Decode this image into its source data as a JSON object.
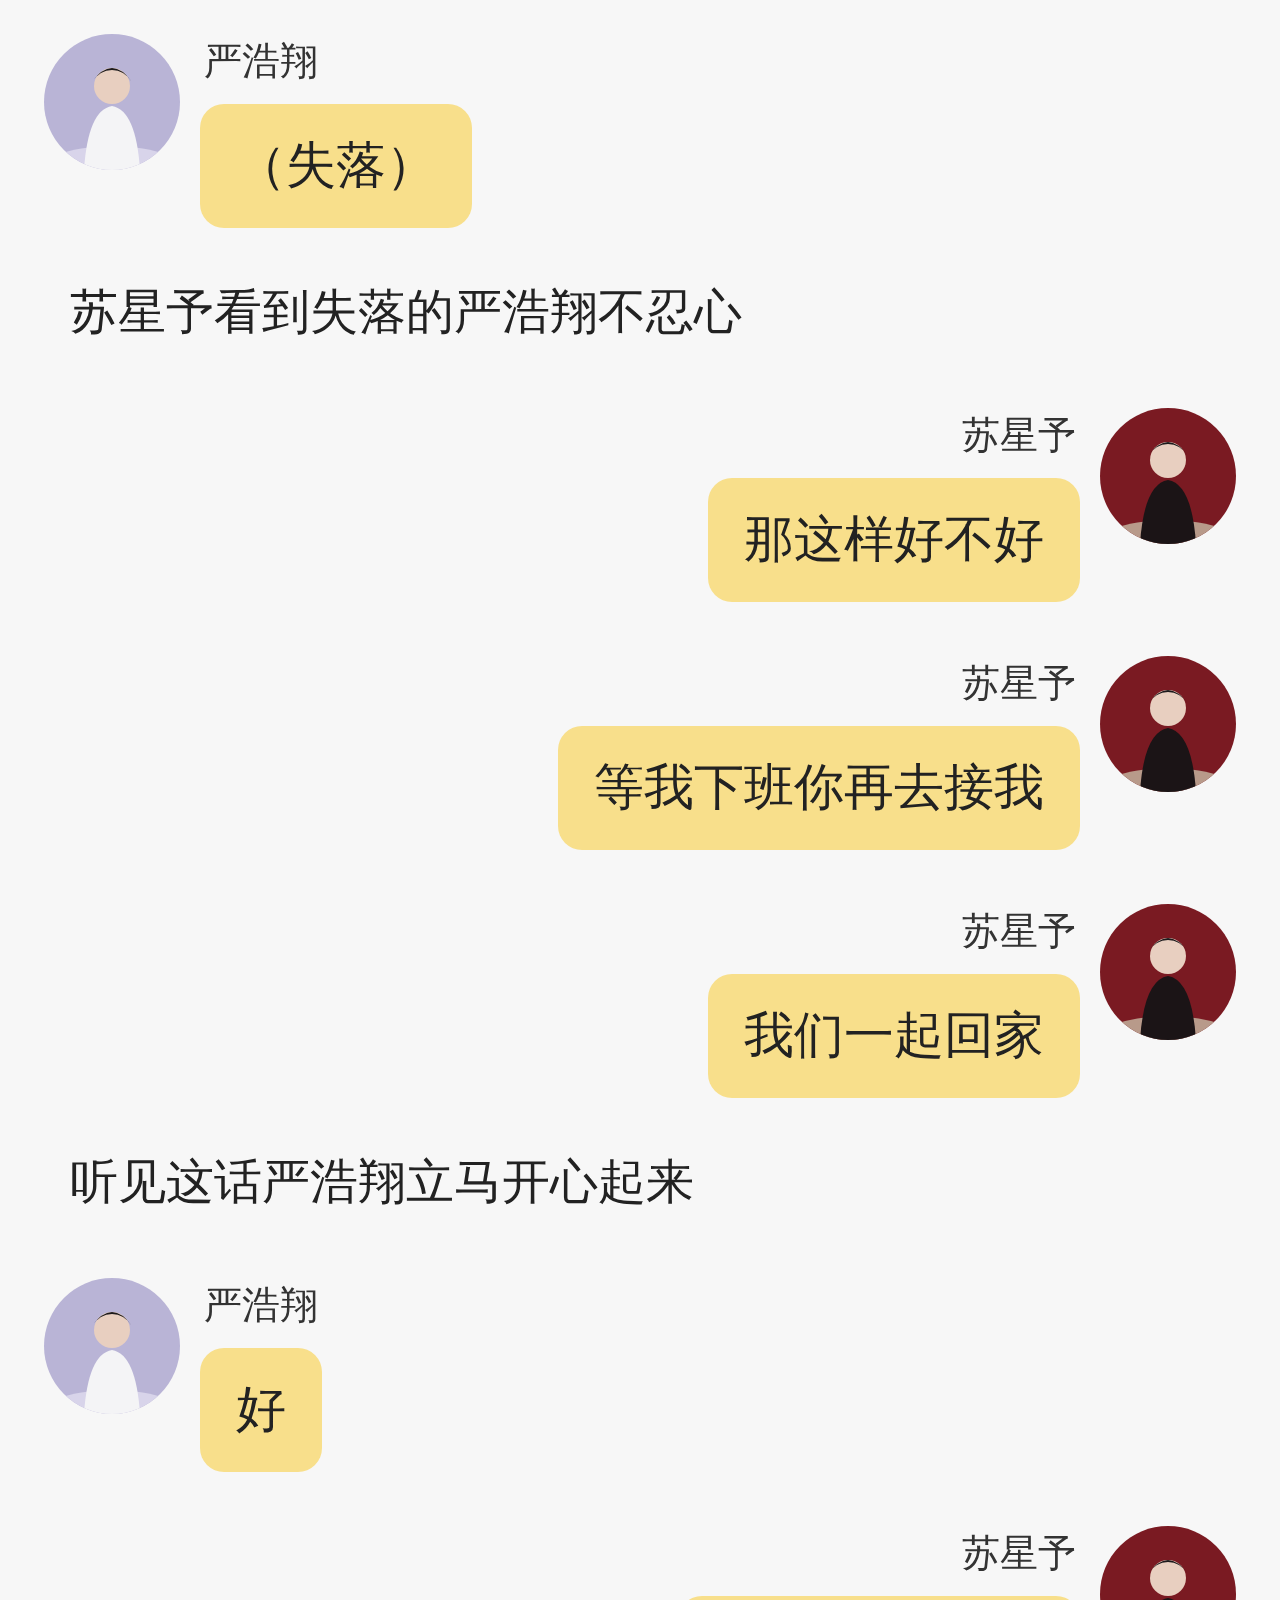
{
  "messages": [
    {
      "kind": "received",
      "name": "严浩翔",
      "text": "（失落）"
    },
    {
      "kind": "narration",
      "text": "苏星予看到失落的严浩翔不忍心"
    },
    {
      "kind": "sent",
      "name": "苏星予",
      "text": "那这样好不好"
    },
    {
      "kind": "sent",
      "name": "苏星予",
      "text": "等我下班你再去接我"
    },
    {
      "kind": "sent",
      "name": "苏星予",
      "text": "我们一起回家"
    },
    {
      "kind": "narration",
      "text": "听见这话严浩翔立马开心起来"
    },
    {
      "kind": "received",
      "name": "严浩翔",
      "text": "好"
    },
    {
      "kind": "sent",
      "name": "苏星予"
    }
  ]
}
